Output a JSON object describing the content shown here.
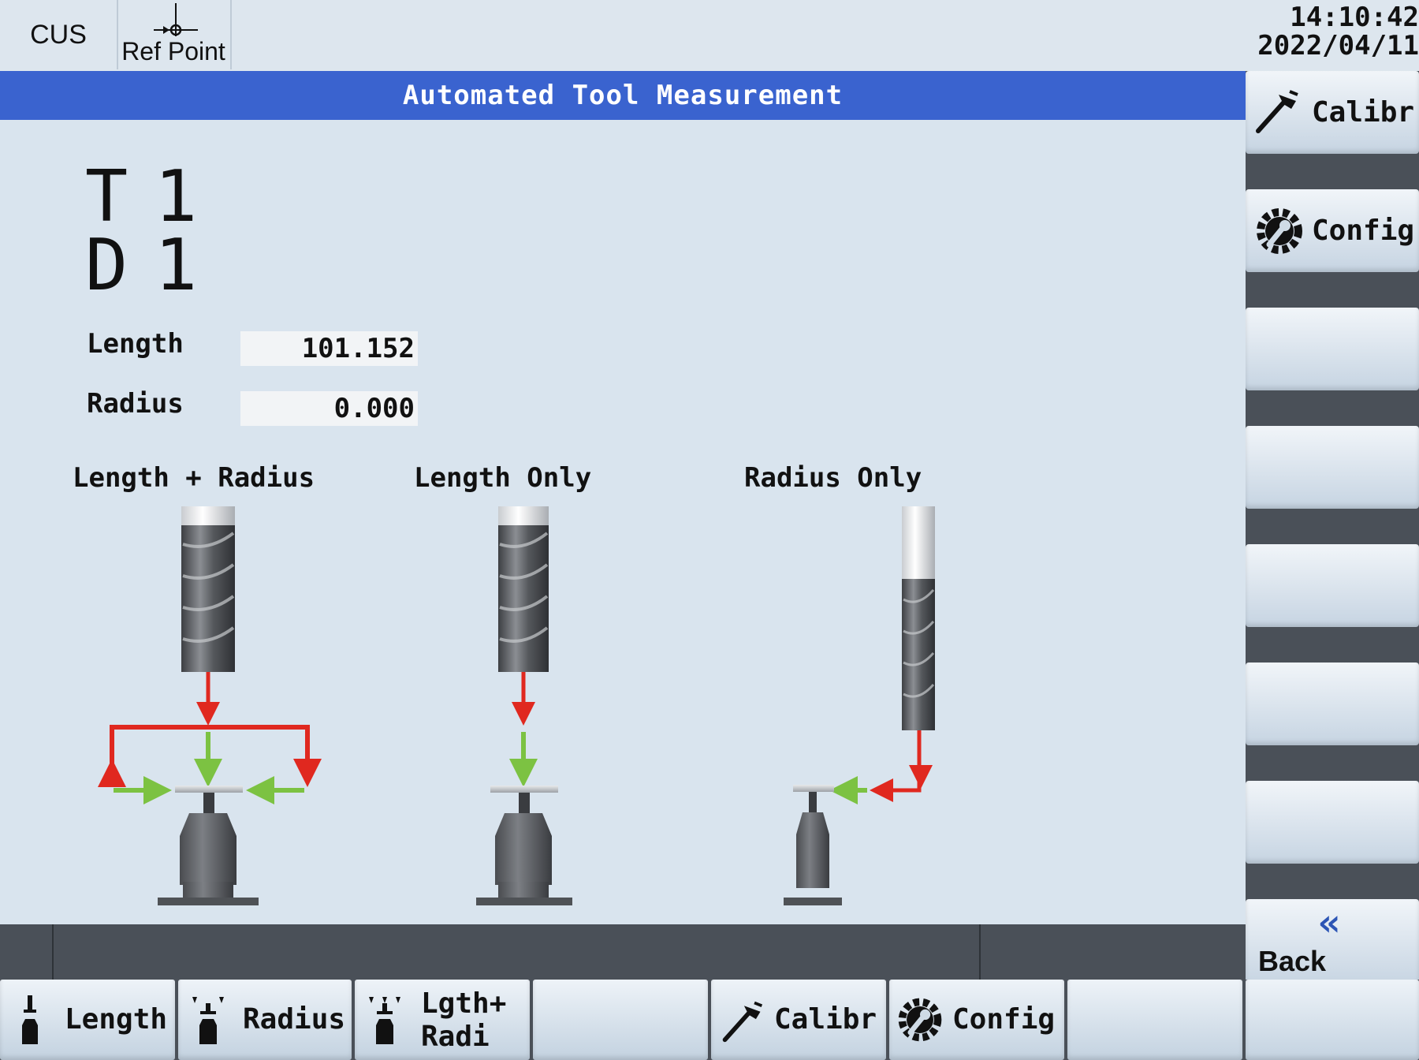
{
  "header": {
    "mode": "CUS",
    "ref_point_label": "Ref Point",
    "time": "14:10:42",
    "date": "2022/04/11"
  },
  "title": "Automated Tool Measurement",
  "tool": {
    "t_letter": "T",
    "t_number": "1",
    "d_letter": "D",
    "d_number": "1"
  },
  "fields": {
    "length_label": "Length",
    "length_value": "101.152",
    "radius_label": "Radius",
    "radius_value": "0.000"
  },
  "diagrams": {
    "length_radius": "Length + Radius",
    "length_only": "Length Only",
    "radius_only": "Radius Only"
  },
  "right_softkeys": {
    "calibrate": "Calibr",
    "config": "Config",
    "back": "Back"
  },
  "bottom_softkeys": {
    "length": "Length",
    "radius": "Radius",
    "lgth_radi_line1": "Lgth+",
    "lgth_radi_line2": "Radi",
    "calibrate": "Calibr",
    "config": "Config"
  },
  "colors": {
    "title_bar": "#3a63cf",
    "arrow_red": "#e0281f",
    "arrow_green": "#7cc242",
    "background": "#d9e4ee"
  }
}
